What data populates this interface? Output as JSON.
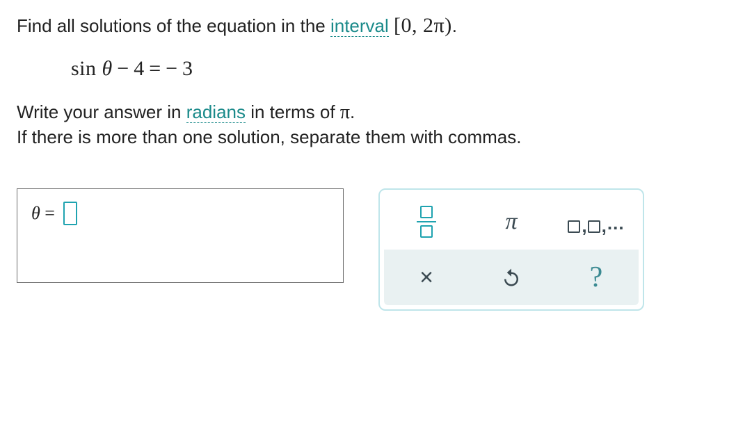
{
  "prompt": {
    "line1_pre": "Find all solutions of the equation in the ",
    "link_interval": "interval",
    "interval_open": "[",
    "interval_a": "0",
    "interval_sep": ", ",
    "interval_b": "2π",
    "interval_close": ")",
    "period1": ".",
    "equation": "sin θ − 4 = − 3",
    "line2_pre": "Write your answer in ",
    "link_radians": "radians",
    "line2_post": " in terms of ",
    "pi": "π",
    "period2": ".",
    "line3": "If there is more than one solution, separate them with commas."
  },
  "answer": {
    "theta": "θ",
    "eq": "=",
    "value": ""
  },
  "palette": {
    "fraction_name": "fraction",
    "pi_label": "π",
    "list_name": "list",
    "clear_label": "×",
    "undo_name": "undo",
    "help_label": "?"
  }
}
